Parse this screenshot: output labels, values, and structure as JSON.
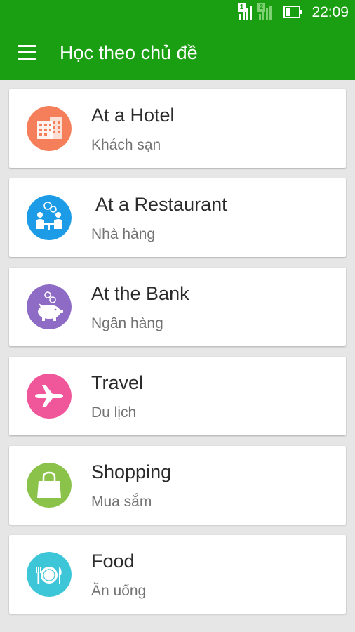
{
  "status_bar": {
    "time": "22:09",
    "sim1": "1",
    "sim2": "2"
  },
  "app_bar": {
    "title": "Học theo chủ đề",
    "menu_icon": "hamburger-menu-icon"
  },
  "topics": [
    {
      "title": "At a Hotel",
      "subtitle": "Khách sạn",
      "icon": "hotel-icon",
      "color": "#f47f5a"
    },
    {
      "title": " At a Restaurant",
      "subtitle": "Nhà hàng",
      "icon": "restaurant-icon",
      "color": "#1c9be6"
    },
    {
      "title": "At the Bank",
      "subtitle": "Ngân hàng",
      "icon": "piggy-bank-icon",
      "color": "#8e6bc5"
    },
    {
      "title": "Travel",
      "subtitle": "Du lịch",
      "icon": "airplane-icon",
      "color": "#f0579a"
    },
    {
      "title": "Shopping",
      "subtitle": "Mua sắm",
      "icon": "shopping-bag-icon",
      "color": "#8bc34a"
    },
    {
      "title": "Food",
      "subtitle": "Ăn uống",
      "icon": "plate-cutlery-icon",
      "color": "#3cc6d8"
    }
  ],
  "colors": {
    "primary": "#1a9e12",
    "background": "#e6e6e6"
  }
}
